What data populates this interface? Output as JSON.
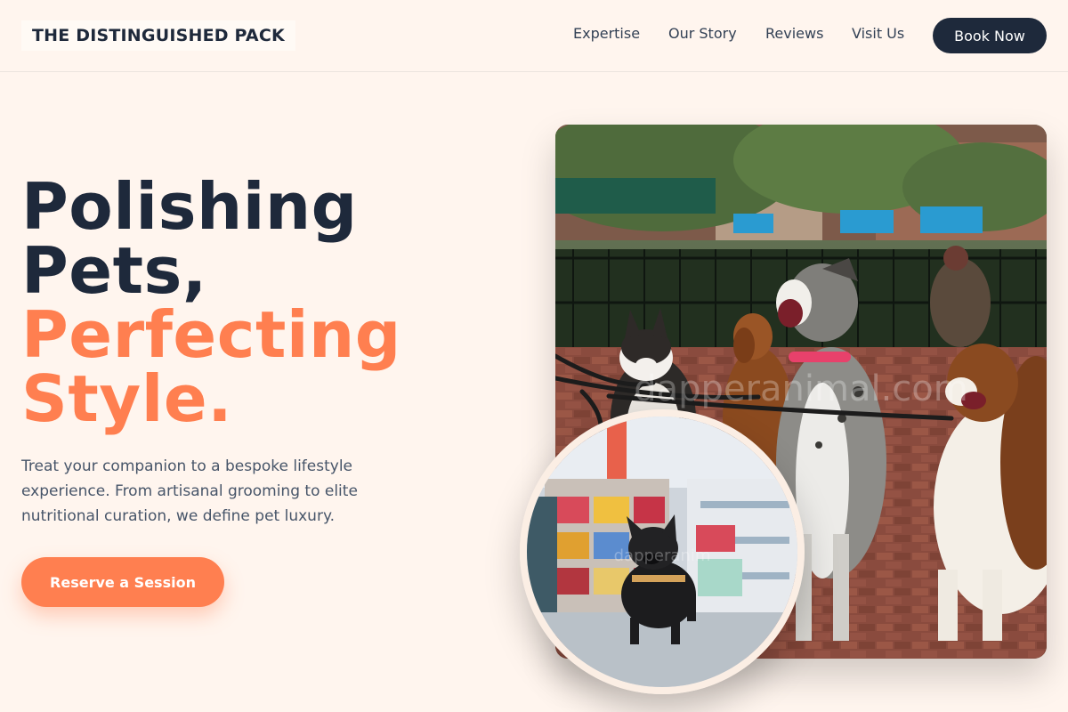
{
  "brand": {
    "name": "THE DISTINGUISHED PACK"
  },
  "nav": {
    "items": [
      {
        "label": "Expertise"
      },
      {
        "label": "Our Story"
      },
      {
        "label": "Reviews"
      },
      {
        "label": "Visit Us"
      }
    ],
    "cta_label": "Book Now"
  },
  "hero": {
    "headline_line1": "Polishing",
    "headline_line2": "Pets,",
    "headline_accent1": "Perfecting",
    "headline_accent2": "Style.",
    "description": "Treat your companion to a bespoke lifestyle experience. From artisanal grooming to elite nutritional curation, we define pet luxury.",
    "cta_label": "Reserve a Session",
    "main_image": {
      "alt": "Four dogs on leashes sitting on a brick sidewalk in a city park",
      "watermark": "dapperanimal.com"
    },
    "inset_image": {
      "alt": "French bulldog in a black jacket standing in a pet store aisle",
      "watermark": "dapperanim"
    }
  },
  "colors": {
    "background": "#fff5ee",
    "navy": "#1e293b",
    "accent": "#ff7f50",
    "body_text": "#475569"
  }
}
